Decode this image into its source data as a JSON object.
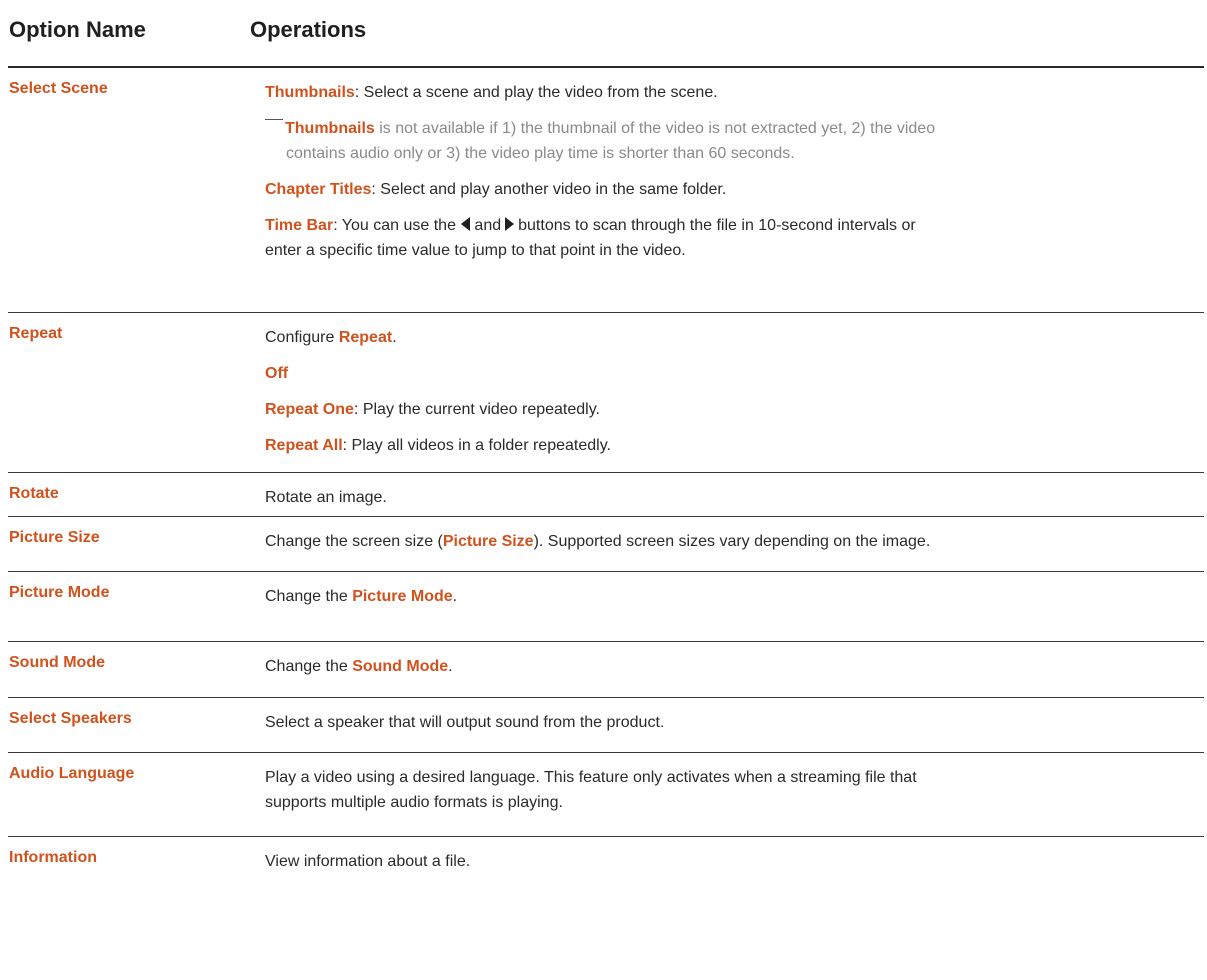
{
  "header": {
    "col1": "Option Name",
    "col2": "Operations"
  },
  "rows": {
    "select_scene": {
      "name": "Select Scene",
      "thumbnails_kw": "Thumbnails",
      "thumbnails_text": ": Select a scene and play the video from the scene.",
      "note_kw": "Thumbnails",
      "note_line1": " is not available if 1) the thumbnail of the video is not extracted yet, 2) the video",
      "note_line2": "contains audio only or 3) the video play time is shorter than 60 seconds.",
      "chapter_kw": "Chapter Titles",
      "chapter_text": ": Select and play another video in the same folder.",
      "timebar_kw": "Time Bar",
      "timebar_text1": ": You can use the",
      "timebar_and": "and",
      "timebar_text2": "buttons to scan through the file in 10-second intervals or",
      "timebar_line2": "enter a specific time value to jump to that point in the video."
    },
    "repeat": {
      "name": "Repeat",
      "configure_text": "Configure ",
      "configure_kw": "Repeat",
      "configure_end": ".",
      "off_kw": "Off",
      "one_kw": "Repeat One",
      "one_text": ": Play the current video repeatedly.",
      "all_kw": "Repeat All",
      "all_text": ": Play all videos in a folder repeatedly."
    },
    "rotate": {
      "name": "Rotate",
      "text": "Rotate an image."
    },
    "picture_size": {
      "name": "Picture Size",
      "text1": "Change the screen size (",
      "kw": "Picture Size",
      "text2": "). Supported screen sizes vary depending on the image."
    },
    "picture_mode": {
      "name": "Picture Mode",
      "text1": "Change the ",
      "kw": "Picture Mode",
      "text2": "."
    },
    "sound_mode": {
      "name": "Sound Mode",
      "text1": "Change the ",
      "kw": "Sound Mode",
      "text2": "."
    },
    "select_speakers": {
      "name": "Select Speakers",
      "text": "Select a speaker that will output sound from the product."
    },
    "audio_language": {
      "name": "Audio Language",
      "line1": "Play a video using a desired language. This feature only activates when a streaming file that",
      "line2": "supports multiple audio formats is playing."
    },
    "information": {
      "name": "Information",
      "text": "View information about a file."
    }
  },
  "colors": {
    "accent": "#d0531d",
    "text": "#2a2a2a",
    "note": "#8a8a8a"
  }
}
